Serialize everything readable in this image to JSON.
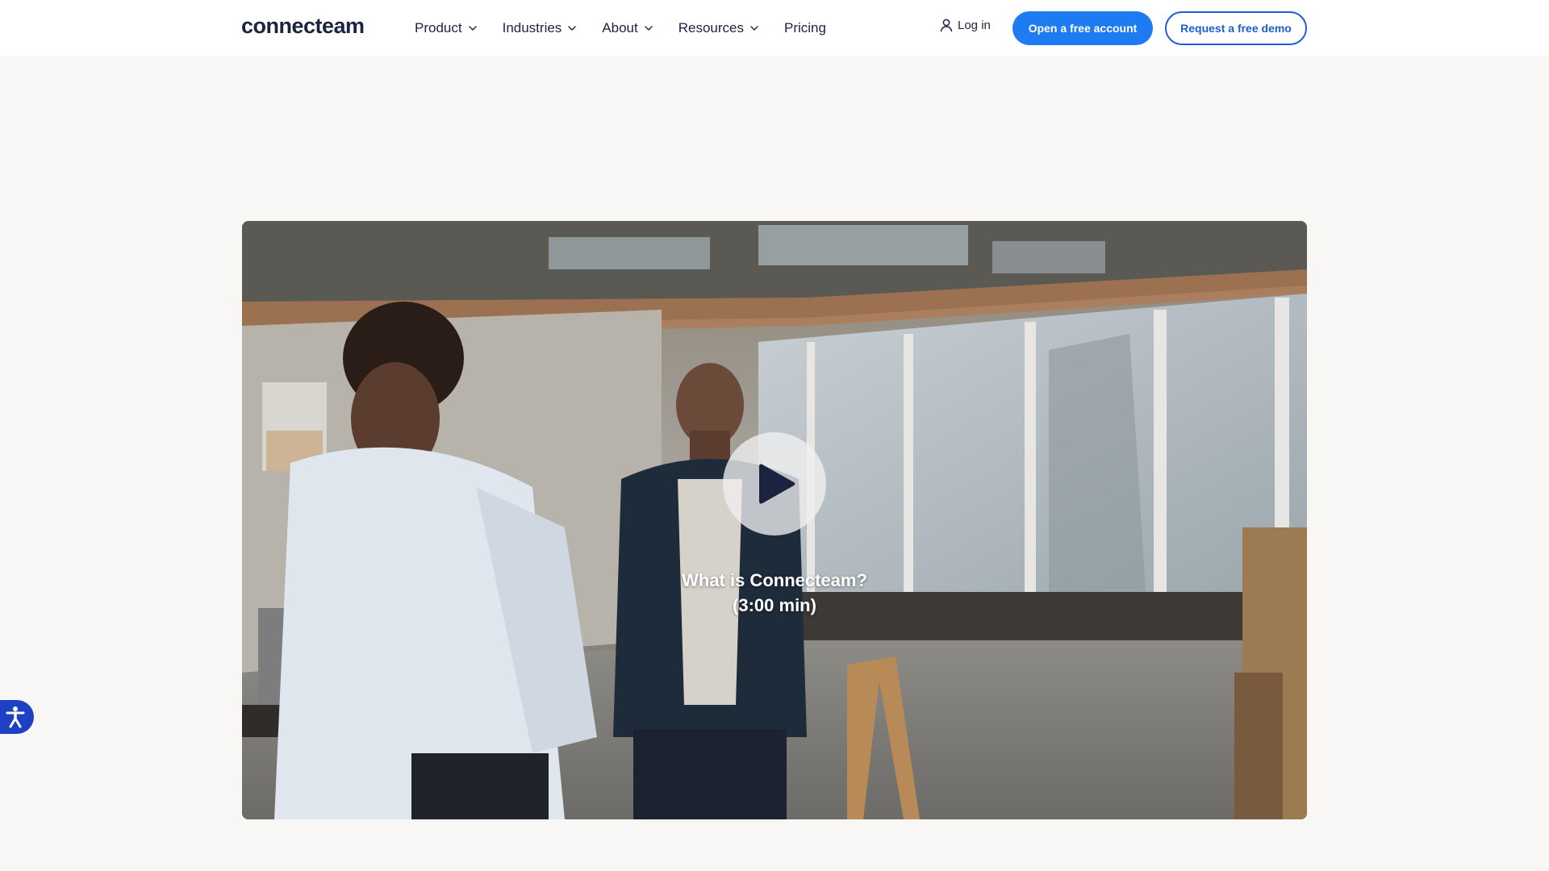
{
  "header": {
    "logo_text": "connecteam",
    "nav": [
      {
        "label": "Product",
        "has_dropdown": true
      },
      {
        "label": "Industries",
        "has_dropdown": true
      },
      {
        "label": "About",
        "has_dropdown": true
      },
      {
        "label": "Resources",
        "has_dropdown": true
      },
      {
        "label": "Pricing",
        "has_dropdown": false
      }
    ],
    "login_label": "Log in",
    "primary_cta": "Open a free account",
    "secondary_cta": "Request a free demo"
  },
  "video": {
    "title": "What is Connecteam?",
    "duration": "(3:00 min)"
  },
  "colors": {
    "accent": "#1f7bf2",
    "accent_dark": "#1f5fd6",
    "page_bg": "#f8f7f5",
    "accessibility_button": "#1e40c4"
  },
  "icons": {
    "login": "user-icon",
    "dropdown": "chevron-down-icon",
    "video_play": "play-icon",
    "accessibility": "accessibility-icon"
  }
}
